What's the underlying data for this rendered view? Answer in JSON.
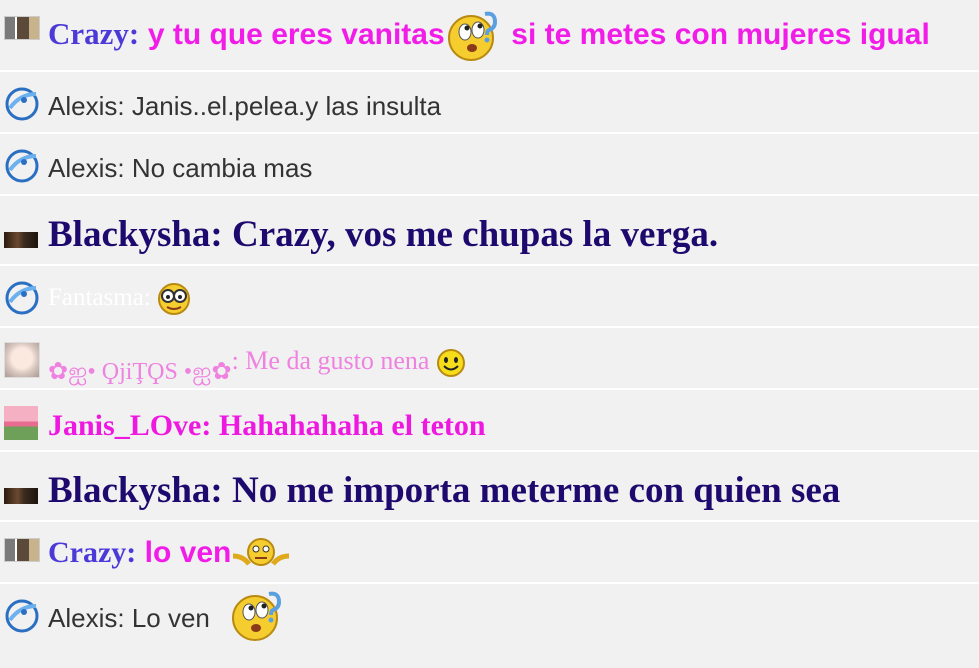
{
  "messages": [
    {
      "user": "Crazy:",
      "text": "y tu que eres vanitas",
      "text2": "si te metes con mujeres igual",
      "avatar_icon": "photo-avatar-icon",
      "emoji_icon": "rolling-eyes-emoji-icon"
    },
    {
      "user": "Alexis:",
      "text": "Janis..el.pelea.y las insulta",
      "avatar_icon": "blue-bird-icon"
    },
    {
      "user": "Alexis:",
      "text": "No cambia mas",
      "avatar_icon": "blue-bird-icon"
    },
    {
      "user": "Blackysha:",
      "text": "Crazy, vos me chupas la verga.",
      "avatar_icon": "dark-avatar-icon"
    },
    {
      "user": "Fantasma:",
      "text": "",
      "avatar_icon": "blue-bird-icon",
      "emoji_icon": "nerd-glasses-emoji-icon"
    },
    {
      "user": "✿ஐ• ϘjiŢϘS •ஐ✿",
      "text": ": Me da gusto nena",
      "avatar_icon": "face-avatar-icon",
      "emoji_icon": "smiley-emoji-icon"
    },
    {
      "user": "Janis_LOve:",
      "text": "Hahahahaha el teton",
      "avatar_icon": "tulip-avatar-icon"
    },
    {
      "user": "Blackysha:",
      "text": "No me importa meterme con quien sea",
      "avatar_icon": "dark-avatar-icon"
    },
    {
      "user": "Crazy:",
      "text": "lo ven",
      "avatar_icon": "photo-avatar-icon",
      "emoji_icon": "shrug-emoji-icon"
    },
    {
      "user": "Alexis:",
      "text": "Lo ven",
      "avatar_icon": "blue-bird-icon",
      "emoji_icon": "rolling-eyes-emoji-icon"
    }
  ],
  "colors": {
    "crazy_name": "#4b3ad8",
    "crazy_text": "#f21ce8",
    "alexis_text": "#333333",
    "blackysha": "#1e0a6e",
    "fantasma": "#ffffff",
    "ojitos": "#ef82e0",
    "janis": "#ee18e0",
    "row_bg": "#f1f1f1"
  }
}
